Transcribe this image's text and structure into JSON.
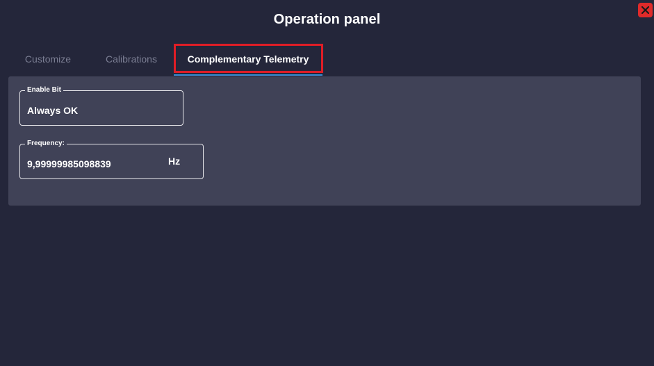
{
  "window": {
    "title": "Operation panel"
  },
  "tabs": [
    {
      "label": "Customize"
    },
    {
      "label": "Calibrations"
    },
    {
      "label": "Complementary Telemetry"
    }
  ],
  "active_tab": "Complementary Telemetry",
  "fields": {
    "enable_bit": {
      "label": "Enable Bit",
      "value": "Always OK"
    },
    "frequency": {
      "label": "Frequency:",
      "value": "9,99999985098839",
      "unit": "Hz"
    }
  },
  "colors": {
    "background": "#24263a",
    "content_background": "#404257",
    "close_button": "#e02a2a",
    "highlight_box": "#e01d26",
    "tab_underline": "#3b8fd6",
    "inactive_tab_text": "#7b7e93"
  },
  "icons": {
    "close": "close-icon"
  }
}
